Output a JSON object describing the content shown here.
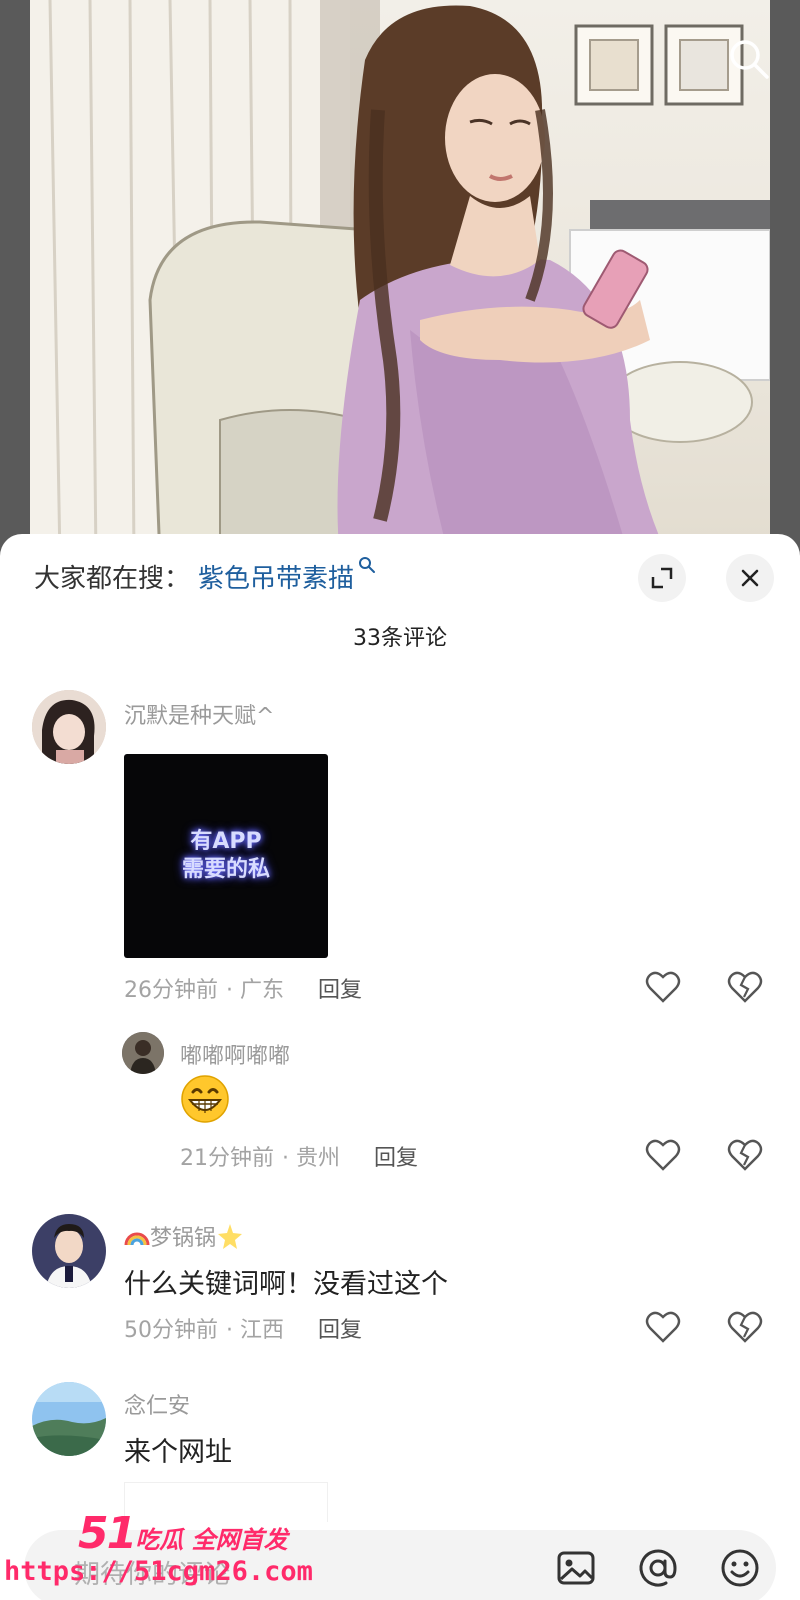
{
  "hero": {
    "search_icon": "search-icon"
  },
  "sheet": {
    "trending_label": "大家都在搜：",
    "trending_term": "紫色吊带素描",
    "expand_icon": "expand-icon",
    "close_icon": "close-icon",
    "comment_count": "33条评论"
  },
  "comments": [
    {
      "user": "沉默是种天赋^",
      "image_text_line1": "有APP",
      "image_text_line2": "需要的私",
      "time": "26分钟前",
      "location": "· 广东",
      "reply": "回复"
    },
    {
      "user": "嘟嘟啊嘟嘟",
      "emoji": "grinning-face",
      "time": "21分钟前",
      "location": "· 贵州",
      "reply": "回复"
    },
    {
      "user": "梦锅锅",
      "text": "什么关键词啊！没看过这个",
      "time": "50分钟前",
      "location": "· 江西",
      "reply": "回复"
    },
    {
      "user": "念仁安",
      "text": "来个网址"
    }
  ],
  "input_bar": {
    "placeholder": "期待你的评论",
    "icons": [
      "image-icon",
      "at-icon",
      "emoji-icon"
    ]
  },
  "watermark": {
    "brand_number": "51",
    "brand_text": "吃瓜 全网首发",
    "url": "https://51cgm26.com"
  },
  "colors": {
    "link": "#1f5f9e",
    "watermark": "#ff2a6a",
    "meta": "#a3a3a3"
  }
}
